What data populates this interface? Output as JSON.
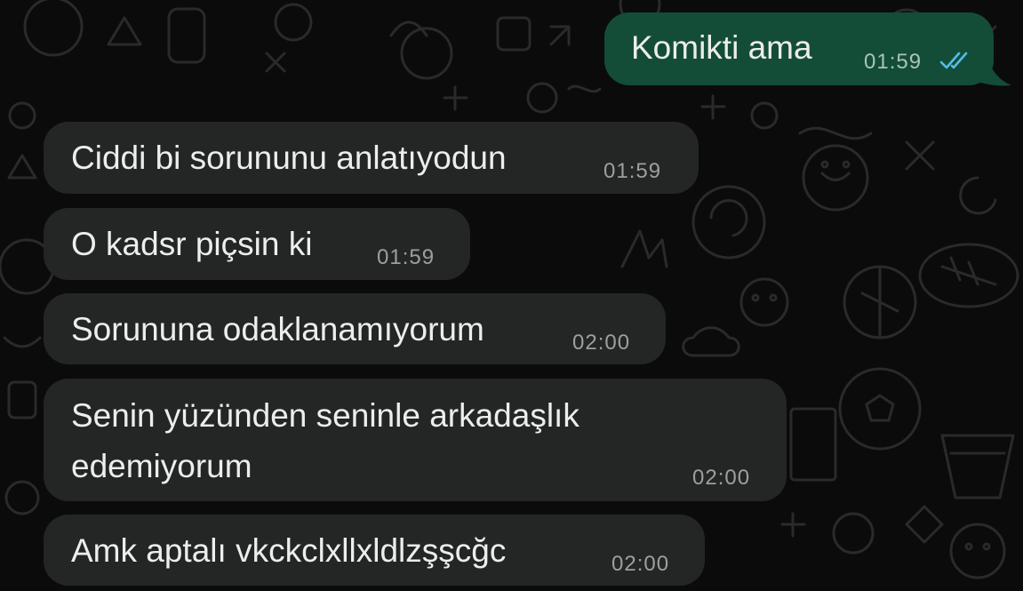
{
  "colors": {
    "background": "#0b0b0b",
    "incoming_bubble": "#242626",
    "outgoing_bubble": "#144d37",
    "text": "#ededed",
    "timestamp": "#9aa0a0",
    "read_ticks": "#53bdeb"
  },
  "messages": [
    {
      "direction": "outgoing",
      "text": "Komikti ama",
      "time": "01:59",
      "status_icon": "double-check-read-icon"
    },
    {
      "direction": "incoming",
      "text": "Ciddi bi sorununu anlatıyodun",
      "time": "01:59"
    },
    {
      "direction": "incoming",
      "text": "O kadsr piçsin ki",
      "time": "01:59"
    },
    {
      "direction": "incoming",
      "text": "Sorununa odaklanamıyorum",
      "time": "02:00"
    },
    {
      "direction": "incoming",
      "text_lines": [
        "Senin yüzünden seninle arkadaşlık",
        "edemiyorum"
      ],
      "time": "02:00"
    },
    {
      "direction": "incoming",
      "text": "Amk aptalı vkckclxllxldlzşşcğc",
      "time": "02:00"
    }
  ]
}
